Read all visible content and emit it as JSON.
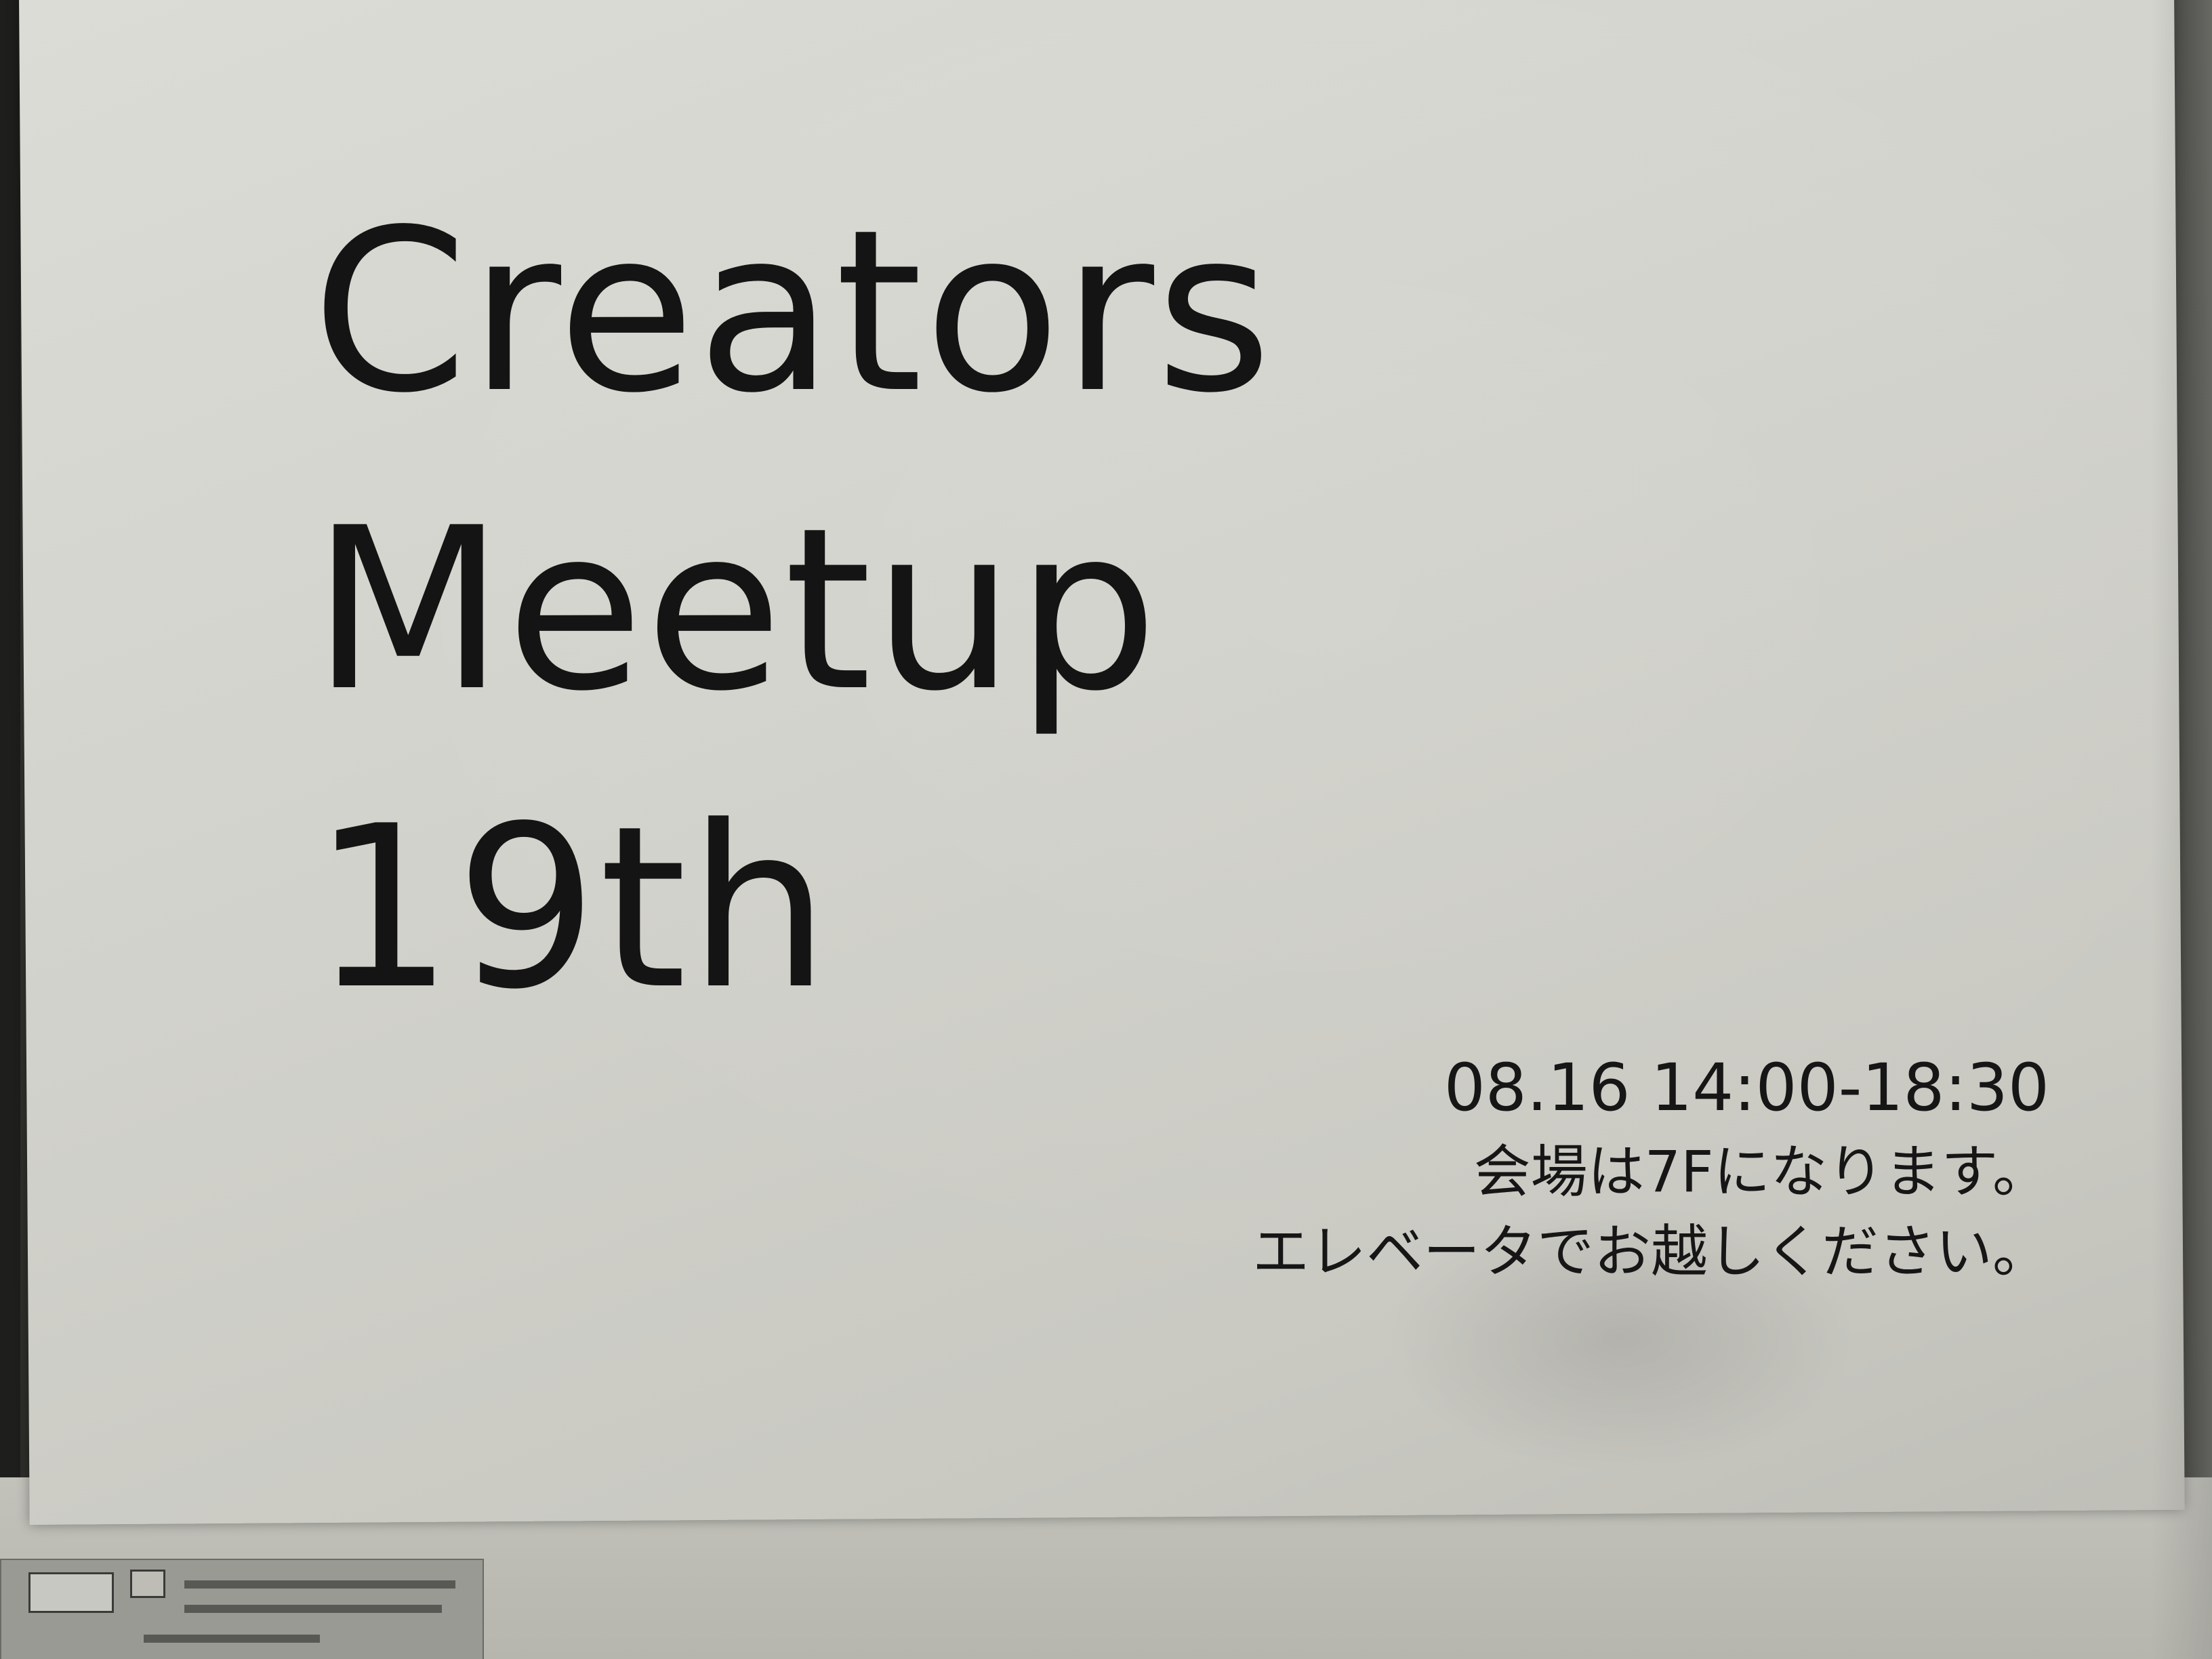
{
  "poster": {
    "title_lines": [
      "Creators",
      "Meetup",
      "19th"
    ],
    "datetime": "08.16 14:00-18:30",
    "venue_note": "会場は7Fになります。",
    "elevator_note": "エレベータでお越しください。"
  },
  "colors": {
    "paper": "#d2d2cc",
    "ink": "#141414",
    "background": "#2b2b28"
  }
}
